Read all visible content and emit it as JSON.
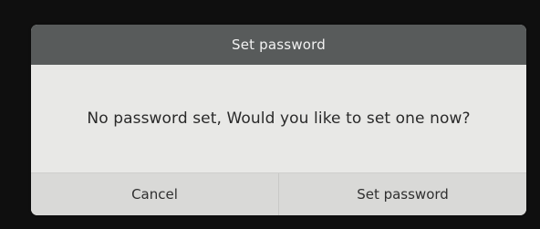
{
  "dialog": {
    "title": "Set password",
    "message": "No password set, Would you like to set one now?",
    "buttons": {
      "cancel": "Cancel",
      "confirm": "Set password"
    }
  },
  "colors": {
    "background": "#0f0f0f",
    "header": "#585b5b",
    "body": "#e8e8e6",
    "actions": "#d9d9d7"
  }
}
